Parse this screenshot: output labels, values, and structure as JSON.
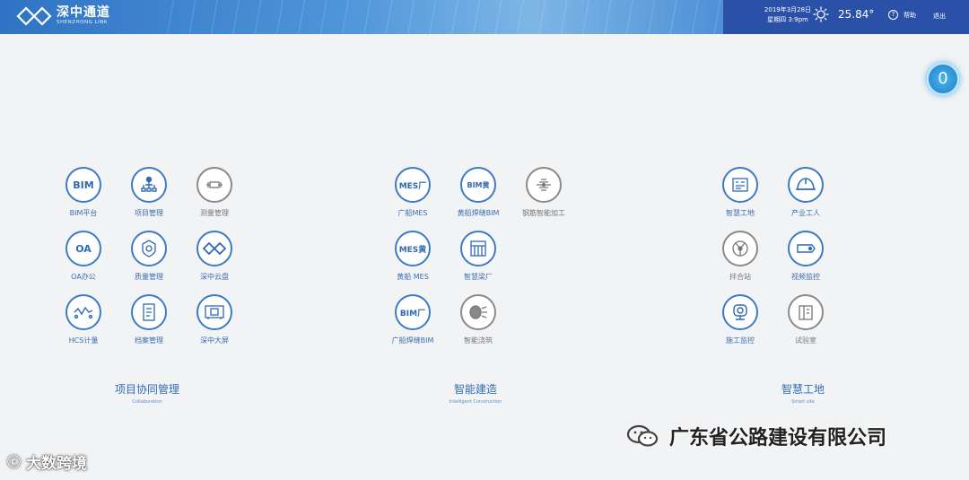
{
  "header": {
    "logo_title": "深中通道",
    "logo_sub": "SHENZHONG LINK",
    "date": "2019年3月28日",
    "weekday_time": "星期四 3:9pm",
    "temperature": "25.84°",
    "help_label": "帮助",
    "logout_label": "退出"
  },
  "notification_count": "0",
  "sections": [
    {
      "title": "项目协同管理",
      "subtitle": "Collaboration"
    },
    {
      "title": "智能建造",
      "subtitle": "Intelligent Construction"
    },
    {
      "title": "智慧工地",
      "subtitle": "Smart site"
    }
  ],
  "apps": [
    {
      "label": "BIM平台",
      "icon_text": "BIM"
    },
    {
      "label": "项目管理"
    },
    {
      "label": "测量管理"
    },
    {
      "label": "OA办公",
      "icon_text": "OA"
    },
    {
      "label": "质量管理"
    },
    {
      "label": "深中云盘"
    },
    {
      "label": "HCS计量"
    },
    {
      "label": "档案管理"
    },
    {
      "label": "深中大屏"
    },
    {
      "label": "广船MES",
      "icon_text": "MES厂"
    },
    {
      "label": "黄船焊缝BIM",
      "icon_text": "BIM黄"
    },
    {
      "label": "钢筋智能加工"
    },
    {
      "label": "黄船 MES",
      "icon_text": "MES黄"
    },
    {
      "label": "智慧梁厂"
    },
    {
      "label": "广船焊缝BIM",
      "icon_text": "BIM厂"
    },
    {
      "label": "智能浇筑"
    },
    {
      "label": "智慧工地"
    },
    {
      "label": "产业工人"
    },
    {
      "label": "拌合站"
    },
    {
      "label": "视频监控"
    },
    {
      "label": "施工监控"
    },
    {
      "label": "试验室"
    }
  ],
  "watermarks": {
    "left": "大数跨境",
    "right": "广东省公路建设有限公司"
  },
  "colors": {
    "accent": "#3c7bc4",
    "header_dark": "#2a50a8",
    "disabled": "#8a8a8a"
  }
}
